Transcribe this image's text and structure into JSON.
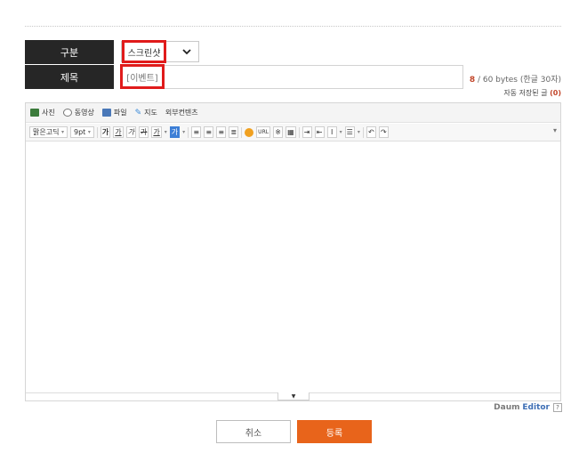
{
  "form": {
    "category_label": "구분",
    "category_value": "스크린샷",
    "title_label": "제목",
    "title_value": "[이벤트]",
    "byte_count": "8",
    "byte_limit": "/ 60 bytes (한글 30자)",
    "autosave_label": "자동 저장된 글",
    "autosave_count": "(0)"
  },
  "toolbar_main": {
    "photo": "사진",
    "video": "동영상",
    "file": "파일",
    "map": "지도",
    "external": "외부컨텐츠"
  },
  "toolbar_format": {
    "font": "맑은고딕",
    "size": "9pt",
    "bold": "가",
    "underline": "가",
    "italic": "가",
    "strike": "가",
    "text_color": "가",
    "bg_color": "가",
    "link": "URL"
  },
  "footer": {
    "brand": "Daum",
    "editor": "Editor",
    "help": "?",
    "cancel": "취소",
    "submit": "등록"
  },
  "colors": {
    "label_bg": "#262626",
    "highlight": "#e01b1b",
    "accent": "#e8641b",
    "brand_blue": "#3e6fb5"
  }
}
